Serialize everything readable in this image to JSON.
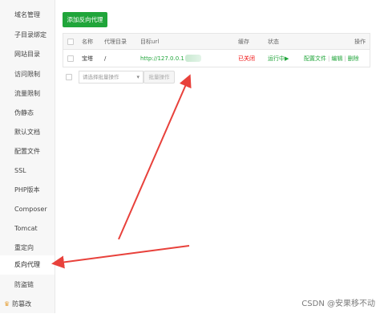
{
  "sidebar": {
    "items": [
      {
        "label": "域名管理",
        "active": false
      },
      {
        "label": "子目录绑定",
        "active": false
      },
      {
        "label": "网站目录",
        "active": false
      },
      {
        "label": "访问限制",
        "active": false
      },
      {
        "label": "流量限制",
        "active": false
      },
      {
        "label": "伪静态",
        "active": false
      },
      {
        "label": "默认文档",
        "active": false
      },
      {
        "label": "配置文件",
        "active": false
      },
      {
        "label": "SSL",
        "active": false
      },
      {
        "label": "PHP版本",
        "active": false
      },
      {
        "label": "Composer",
        "active": false
      },
      {
        "label": "Tomcat",
        "active": false
      },
      {
        "label": "重定向",
        "active": false
      },
      {
        "label": "反向代理",
        "active": true
      },
      {
        "label": "防盗链",
        "active": false
      },
      {
        "label": "防篡改",
        "active": false
      }
    ]
  },
  "toolbar": {
    "add_label": "添加反向代理"
  },
  "table": {
    "headers": {
      "name": "名称",
      "proxy_dir": "代理目录",
      "target_url": "目标url",
      "cache": "缓存",
      "status": "状态",
      "actions": "操作"
    },
    "rows": [
      {
        "name": "宝塔",
        "proxy_dir": "/",
        "target_url": "http://127.0.0.1",
        "cache": "已关闭",
        "status": "运行中▶",
        "action_config": "配置文件",
        "action_edit": "编辑",
        "action_delete": "删除"
      }
    ]
  },
  "bulk": {
    "select_placeholder": "请选择批量操作",
    "button_label": "批量操作"
  },
  "watermark": "CSDN @安果移不动",
  "colors": {
    "primary_green": "#20a53a",
    "danger_red": "#ef0808",
    "annotation_arrow": "#e8413b"
  }
}
